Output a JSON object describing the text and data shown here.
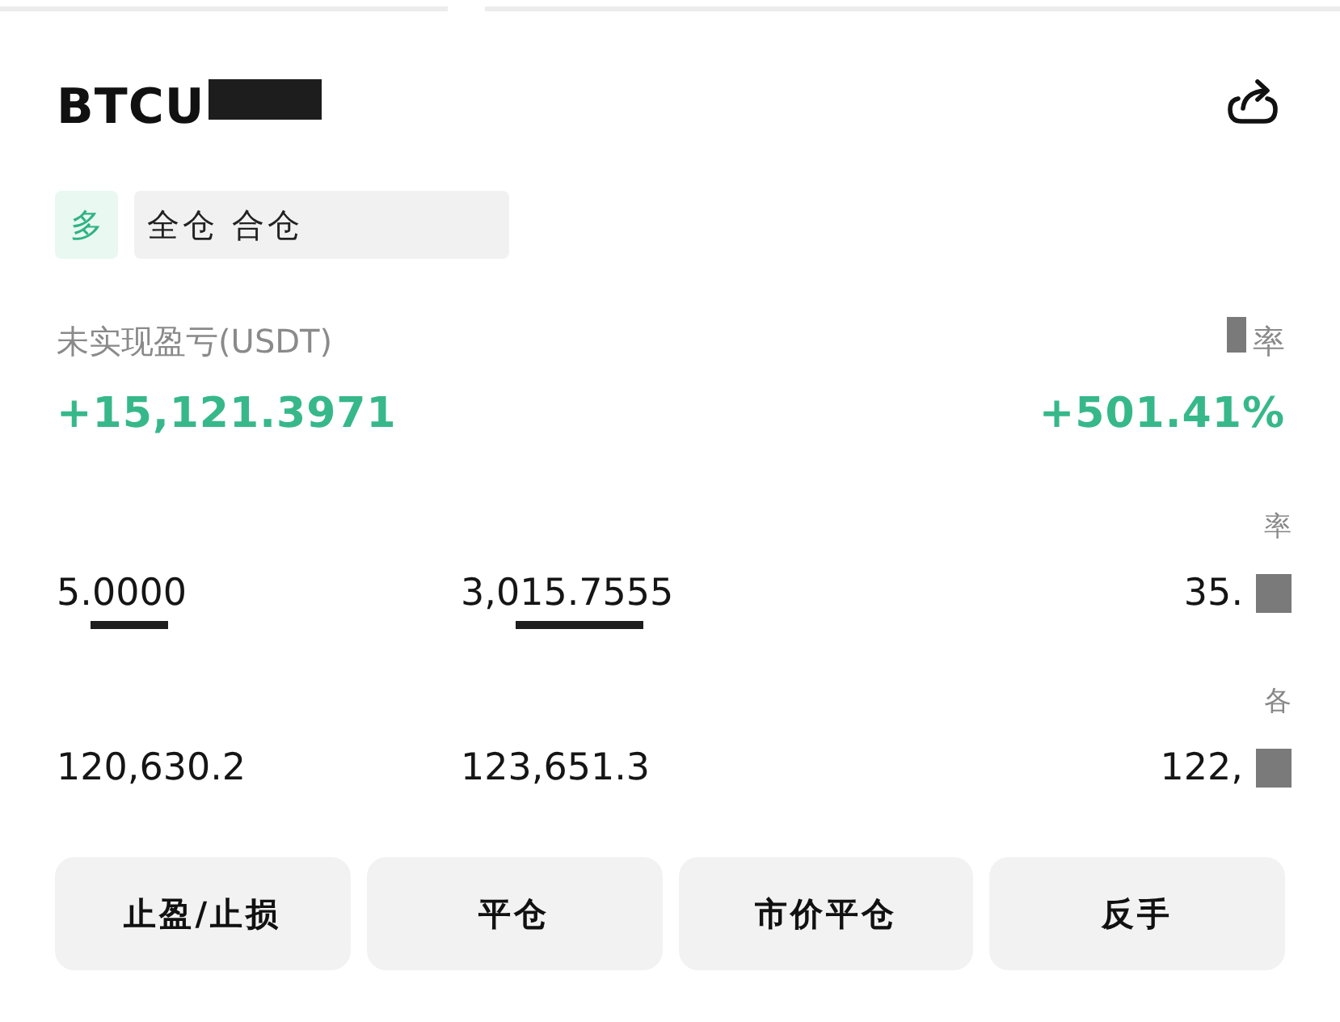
{
  "header": {
    "symbol": "BTCU",
    "redacted": true
  },
  "tags": [
    {
      "kind": "side",
      "label": "多"
    },
    {
      "kind": "margin",
      "label": "全仓 合仓"
    }
  ],
  "summary": {
    "pnl_label": "未实现盈亏(USDT)",
    "pnl_value": "+15,121.3971",
    "roi_label": "率",
    "roi_value": "+501.41%",
    "roi_label_redacted": true
  },
  "stats": [
    {
      "cells": [
        {
          "value": "5.0000",
          "redacted": true
        },
        {
          "value": "3,015.7555",
          "redacted": true
        },
        {
          "label": "率",
          "value": "35.",
          "redacted": true
        }
      ]
    },
    {
      "cells": [
        {
          "value": "120,630.2",
          "redacted": false
        },
        {
          "value": "123,651.3",
          "redacted": false
        },
        {
          "label": "各",
          "value": "122,",
          "redacted": true
        }
      ]
    }
  ],
  "buttons": [
    {
      "label": "止盈/止损"
    },
    {
      "label": "平仓"
    },
    {
      "label": "市价平仓"
    },
    {
      "label": "反手"
    }
  ]
}
